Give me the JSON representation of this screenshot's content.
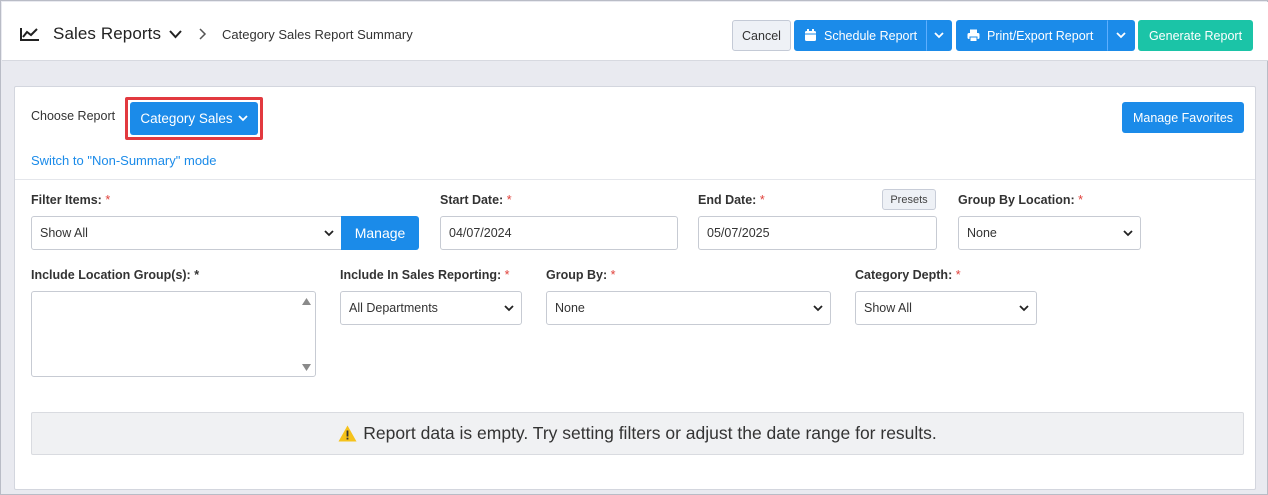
{
  "header": {
    "title": "Sales Reports",
    "breadcrumb": "Category Sales Report Summary",
    "cancel_label": "Cancel",
    "schedule_label": "Schedule Report",
    "print_label": "Print/Export Report",
    "generate_label": "Generate Report"
  },
  "report": {
    "choose_label": "Choose Report",
    "selected_report": "Category Sales",
    "manage_favorites_label": "Manage Favorites",
    "switch_mode_link": "Switch to \"Non-Summary\" mode"
  },
  "filters": {
    "filter_items": {
      "label": "Filter Items:",
      "required": "*",
      "value": "Show All",
      "manage_label": "Manage"
    },
    "start_date": {
      "label": "Start Date:",
      "required": "*",
      "value": "04/07/2024"
    },
    "end_date": {
      "label": "End Date:",
      "required": "*",
      "value": "05/07/2025",
      "presets_label": "Presets"
    },
    "group_by_location": {
      "label": "Group By Location:",
      "required": "*",
      "value": "None"
    },
    "include_location_groups": {
      "label": "Include Location Group(s): *"
    },
    "include_in_sales": {
      "label": "Include In Sales Reporting:",
      "required": "*",
      "value": "All Departments"
    },
    "group_by": {
      "label": "Group By:",
      "required": "*",
      "value": "None"
    },
    "category_depth": {
      "label": "Category Depth:",
      "required": "*",
      "value": "Show All"
    }
  },
  "message": {
    "empty_text": "Report data is empty. Try setting filters or adjust the date range for results."
  },
  "colors": {
    "primary": "#1b8be9",
    "generate": "#1bc4a7",
    "required": "#e0403a",
    "highlight": "#e2393f",
    "warning": "#f5c21b"
  },
  "icons": [
    "chart-icon",
    "chevron-down-icon",
    "chevron-right-icon",
    "calendar-icon",
    "printer-icon",
    "warning-icon"
  ]
}
